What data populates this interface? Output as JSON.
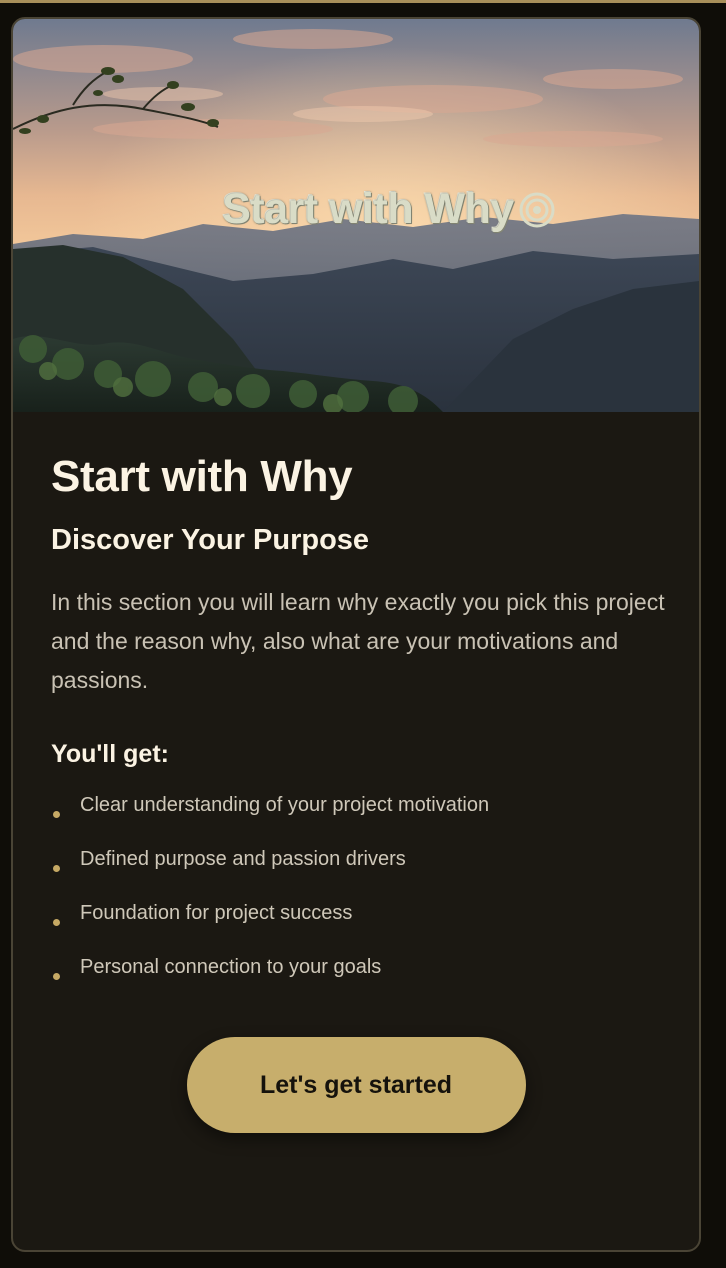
{
  "hero": {
    "title": "Start with Why",
    "icon": "target-icon"
  },
  "card": {
    "title": "Start with Why",
    "subtitle": "Discover Your Purpose",
    "description": "In this section you will learn why exactly you pick this project and the reason why, also what are your motivations and passions.",
    "benefits_heading": "You'll get:",
    "benefits": [
      "Clear understanding of your project motivation",
      "Defined purpose and passion drivers",
      "Foundation for project success",
      "Personal connection to your goals"
    ],
    "cta_label": "Let's get started"
  },
  "colors": {
    "background": "#0f0d08",
    "card": "#1b1812",
    "accent": "#c7ae6c",
    "heading": "#fbf3e3",
    "body_text": "#c9c2b4"
  }
}
